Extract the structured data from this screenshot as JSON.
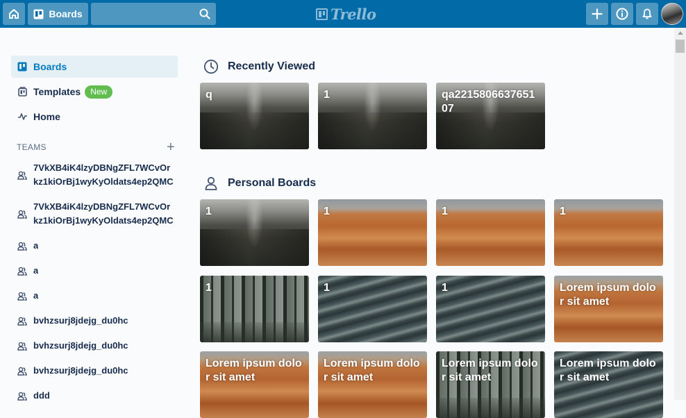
{
  "header": {
    "boards_label": "Boards",
    "search_placeholder": "",
    "logo_text": "Trello"
  },
  "sidebar": {
    "nav": [
      {
        "label": "Boards",
        "icon": "boards-icon",
        "active": true
      },
      {
        "label": "Templates",
        "icon": "templates-icon",
        "badge": "New"
      },
      {
        "label": "Home",
        "icon": "activity-icon"
      }
    ],
    "teams_heading": "TEAMS",
    "teams": [
      {
        "line1": "7VkXB4iK4lzyDBNgZFL7WCvOr",
        "line2": "kz1kiOrBj1wyKyOldats4ep2QMC"
      },
      {
        "line1": "7VkXB4iK4lzyDBNgZFL7WCvOr",
        "line2": "kz1kiOrBj1wyKyOldats4ep2QMC"
      },
      {
        "line1": "a"
      },
      {
        "line1": "a"
      },
      {
        "line1": "a"
      },
      {
        "line1": "bvhzsurj8jdejg_du0hc"
      },
      {
        "line1": "bvhzsurj8jdejg_du0hc"
      },
      {
        "line1": "bvhzsurj8jdejg_du0hc"
      },
      {
        "line1": "ddd"
      }
    ]
  },
  "main": {
    "recently_viewed_title": "Recently Viewed",
    "recently_viewed": [
      {
        "name": "q",
        "background": "mountain"
      },
      {
        "name": "1",
        "background": "mountain"
      },
      {
        "name": "qa221580663765107",
        "background": "mountain"
      }
    ],
    "personal_boards_title": "Personal Boards",
    "personal_boards": [
      {
        "name": "1",
        "background": "mountain"
      },
      {
        "name": "1",
        "background": "desert"
      },
      {
        "name": "1",
        "background": "desert"
      },
      {
        "name": "1",
        "background": "desert"
      },
      {
        "name": "1",
        "background": "forest"
      },
      {
        "name": "1",
        "background": "water"
      },
      {
        "name": "1",
        "background": "water"
      },
      {
        "name": "Lorem ipsum dolor sit amet",
        "background": "desert"
      },
      {
        "name": "Lorem ipsum dolor sit amet",
        "background": "desert"
      },
      {
        "name": "Lorem ipsum dolor sit amet",
        "background": "desert"
      },
      {
        "name": "Lorem ipsum dolor sit amet",
        "background": "forest"
      },
      {
        "name": "Lorem ipsum dolor sit amet",
        "background": "water"
      }
    ]
  },
  "colors": {
    "header": "#026aa7",
    "active_nav_bg": "#e4f0f6",
    "active_nav_text": "#0079bf",
    "new_badge": "#61bd4f"
  }
}
